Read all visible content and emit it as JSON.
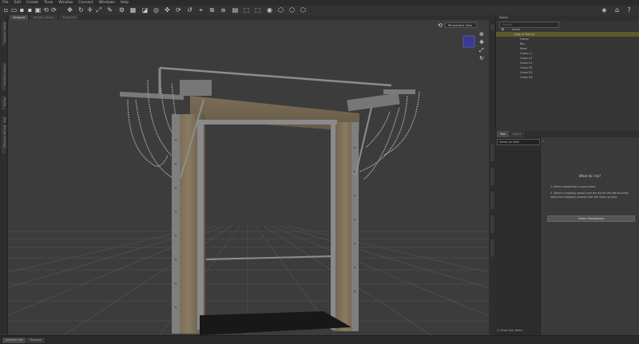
{
  "menu": [
    "File",
    "Edit",
    "Create",
    "Tools",
    "Window",
    "Connect",
    "Windows",
    "Help"
  ],
  "toolbar_icons": [
    "new-icon",
    "open-icon",
    "save-icon",
    "save-as-icon",
    "merge-icon",
    "undo-icon",
    "redo-icon",
    "universal-tool-icon",
    "rotate-tool-icon",
    "translate-tool-icon",
    "scale-tool-icon",
    "node-weight-icon",
    "joint-editor-icon",
    "geometry-editor-icon",
    "surface-selection-icon",
    "region-navigator-icon",
    "pose-tool-icon",
    "transform-icon",
    "active-pose-icon",
    "scene-icon",
    "render-icon",
    "render-settings-icon",
    "camera-icon",
    "smart-content-icon",
    "pin-icon",
    "home-icon",
    "help-icon"
  ],
  "left_tabs": [
    "Smart Content",
    "Content Library",
    "Posing",
    "Shaping",
    "Render Settings"
  ],
  "viewport": {
    "tabs": [
      "Viewport",
      "Render Library",
      "Script IDE"
    ],
    "camera_dropdown": "Perspective View"
  },
  "scene": {
    "title": "Scene",
    "search_placeholder": "Search",
    "items": [
      {
        "label": "Cage of Nature",
        "selected": true
      },
      {
        "label": "Frame",
        "selected": false
      },
      {
        "label": "Bar",
        "selected": false
      },
      {
        "label": "Steel",
        "selected": false
      },
      {
        "label": "Chain L1",
        "selected": false
      },
      {
        "label": "Chain L2",
        "selected": false
      },
      {
        "label": "Chain L3",
        "selected": false
      },
      {
        "label": "Chain R1",
        "selected": false
      },
      {
        "label": "Chain R2",
        "selected": false
      },
      {
        "label": "Chain R3",
        "selected": false
      }
    ]
  },
  "params": {
    "tabs": [
      "Tool",
      "Scene"
    ],
    "select_label": "Select an Item",
    "side_tabs": [
      "Parameters",
      "Surfaces",
      "Lights",
      "Cameras",
      "Animate2"
    ],
    "help_title": "What do I do?",
    "step1": "1. Select something in your scene.",
    "step2": "2. Select a property group from the list on the left and then adjust the property controls that will show up here.",
    "video_button": "Video: Parameters",
    "show_sub_items": "Show Sub Items"
  },
  "status_tabs": [
    "aniMate Lite",
    "Timeline"
  ]
}
